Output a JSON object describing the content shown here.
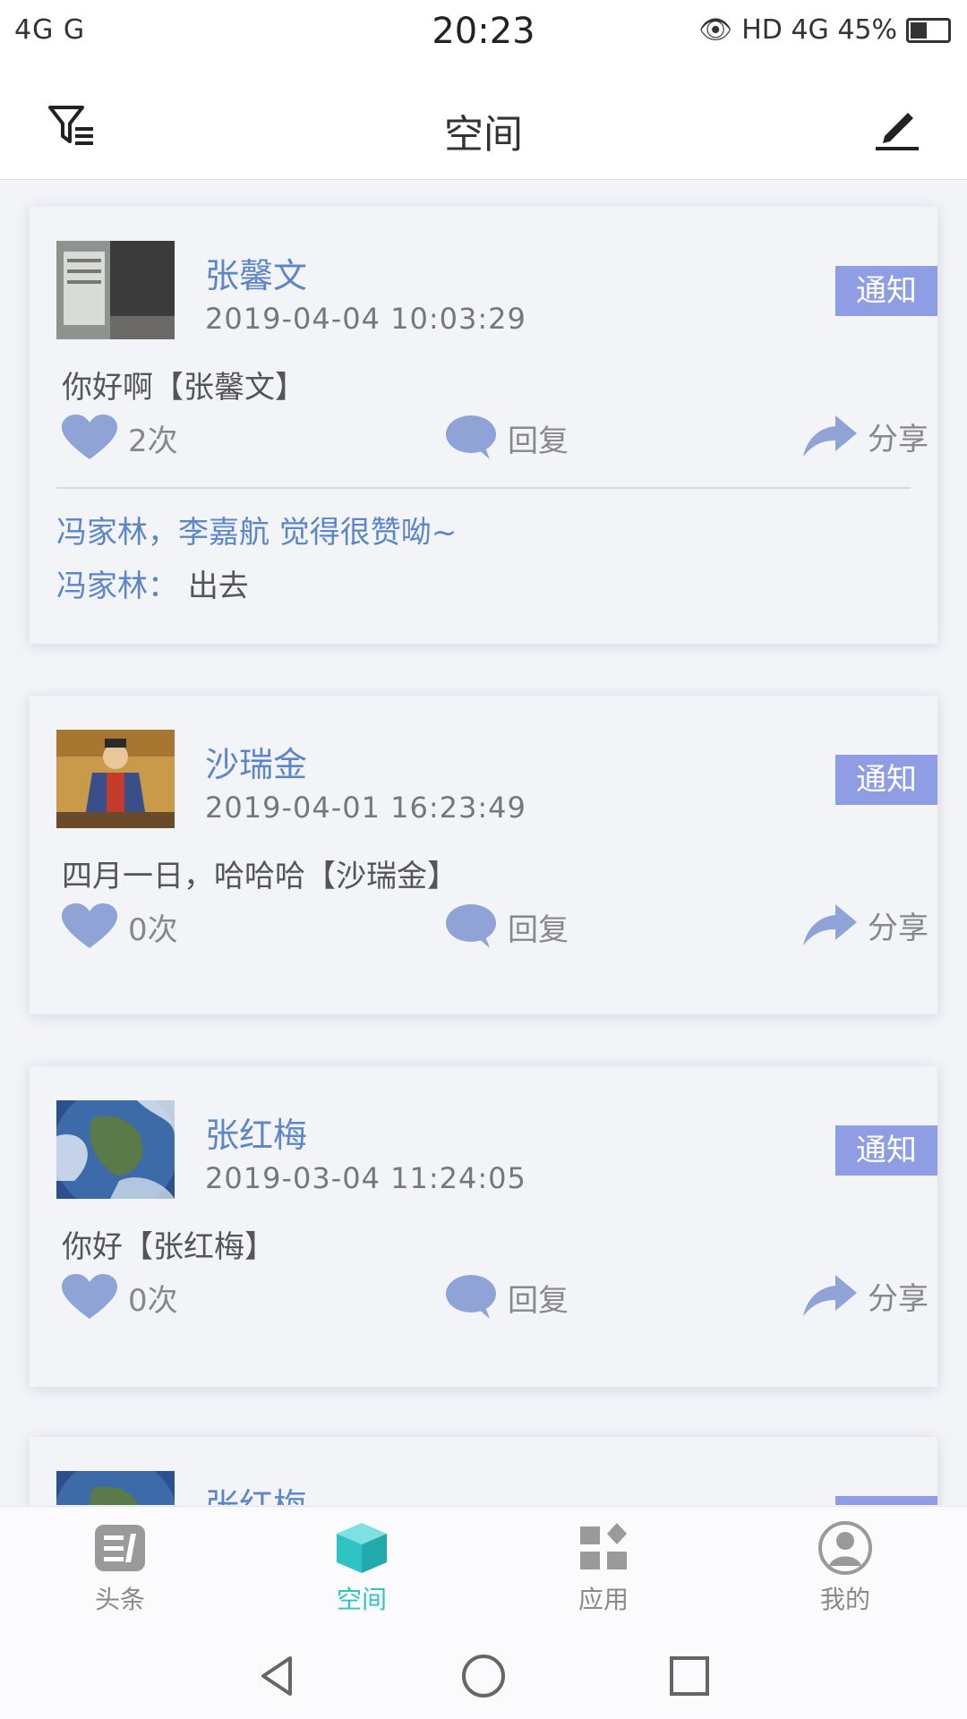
{
  "status_bar": {
    "left": "4G G",
    "time": "20:23",
    "right": "HD 4G 45%"
  },
  "header": {
    "title": "空间"
  },
  "posts": [
    {
      "name": "张馨文",
      "time": "2019-04-04 10:03:29",
      "badge": "通知",
      "content": "你好啊【张馨文】",
      "likes": "2次",
      "reply": "回复",
      "share": "分享",
      "like_summary": "冯家林，李嘉航 觉得很赞呦~",
      "comment_author": "冯家林：",
      "comment_text": "出去"
    },
    {
      "name": "沙瑞金",
      "time": "2019-04-01 16:23:49",
      "badge": "通知",
      "content": "四月一日，哈哈哈【沙瑞金】",
      "likes": "0次",
      "reply": "回复",
      "share": "分享"
    },
    {
      "name": "张红梅",
      "time": "2019-03-04 11:24:05",
      "badge": "通知",
      "content": "你好【张红梅】",
      "likes": "0次",
      "reply": "回复",
      "share": "分享"
    },
    {
      "name": "张红梅"
    }
  ],
  "bottom_nav": [
    {
      "label": "头条",
      "icon": "headlines-icon"
    },
    {
      "label": "空间",
      "icon": "space-cube-icon",
      "active": true
    },
    {
      "label": "应用",
      "icon": "apps-grid-icon"
    },
    {
      "label": "我的",
      "icon": "profile-icon"
    }
  ],
  "colors": {
    "accent": "#2fc3c6",
    "name_blue": "#5d86c9",
    "badge": "#8f9ee4",
    "icon_blue": "#8fa3d6"
  }
}
